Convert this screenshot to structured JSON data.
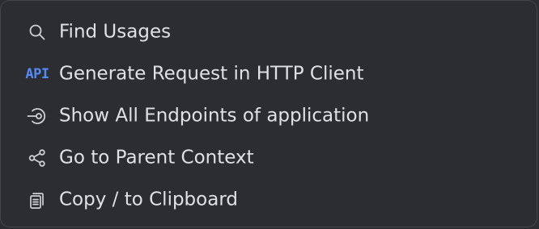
{
  "menu": {
    "items": [
      {
        "label": "Find Usages",
        "icon": "search-icon"
      },
      {
        "label": "Generate Request in HTTP Client",
        "icon": "api-icon",
        "icon_text": "API"
      },
      {
        "label": "Show All Endpoints of application",
        "icon": "endpoints-icon"
      },
      {
        "label": "Go to Parent Context",
        "icon": "share-icon"
      },
      {
        "label": "Copy / to Clipboard",
        "icon": "copy-icon"
      }
    ]
  },
  "colors": {
    "background": "#2b2d30",
    "border": "#43454a",
    "text": "#dfe1e5",
    "icon": "#ced0d6",
    "accent": "#548af7"
  }
}
